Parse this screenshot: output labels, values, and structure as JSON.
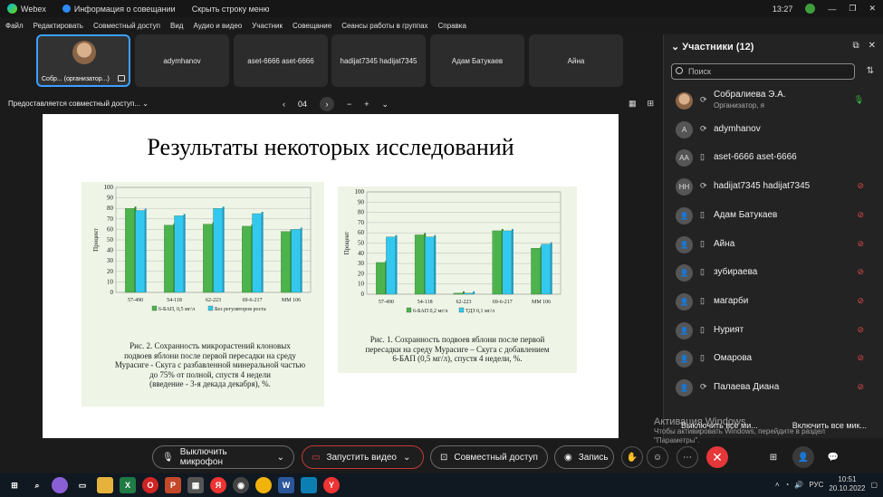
{
  "titlebar": {
    "app": "Webex",
    "meeting_info": "Информация о совещании",
    "hide_menu": "Скрыть строку меню",
    "time": "13:27"
  },
  "menu": [
    "Файл",
    "Редактировать",
    "Совместный доступ",
    "Вид",
    "Аудио и видео",
    "Участник",
    "Совещание",
    "Сеансы работы в группах",
    "Справка"
  ],
  "tiles": [
    {
      "label": "Собр... (организатор...)"
    },
    {
      "label": "adymhanov"
    },
    {
      "label": "aset-6666 aset-6666"
    },
    {
      "label": "hadijat7345 hadijat7345"
    },
    {
      "label": "Адам Батукаев"
    },
    {
      "label": "Айна"
    }
  ],
  "share_bar": {
    "label": "Предоставляется совместный доступ...",
    "page": "04",
    "prev": "‹",
    "next": "›",
    "minus": "−",
    "plus": "+"
  },
  "slide": {
    "title": "Результаты некоторых исследований",
    "caption_left": [
      "Рис. 2. Сохранность микрорастений клоновых",
      "подвоев яблони после первой пересадки на среду",
      "Мурасиге - Скуга с разбавленной минеральной частью",
      "до 75% от полной, спустя 4 недели",
      "(введение - 3-я декада декабря), %."
    ],
    "caption_right": [
      "Рис. 1. Сохранность подвоев яблони после первой",
      "пересадки на среду Мурасиге – Скуга с добавлением",
      "6-БАП (0,5 мг/л), спустя 4 недели, %."
    ]
  },
  "chart_data": [
    {
      "type": "bar",
      "categories": [
        "57-490",
        "54-118",
        "62-223",
        "69-6-217",
        "ММ 106"
      ],
      "series": [
        {
          "name": "6-БАП, 0,5 мг/л",
          "values": [
            80,
            64,
            65,
            63,
            58
          ]
        },
        {
          "name": "Без регуляторов роста",
          "values": [
            78,
            73,
            80,
            75,
            60
          ]
        }
      ],
      "ylabel": "Процент",
      "ylim": [
        0,
        100
      ],
      "yticks": [
        0,
        10,
        20,
        30,
        40,
        50,
        60,
        70,
        80,
        90,
        100
      ],
      "colors": [
        "#4db34d",
        "#33c8ef"
      ],
      "legend": "bottom",
      "grid": true
    },
    {
      "type": "bar",
      "categories": [
        "57-490",
        "54-118",
        "62-223",
        "69-6-217",
        "ММ 106"
      ],
      "series": [
        {
          "name": "6-БАП 0,2 мг/л",
          "values": [
            31,
            58,
            1,
            62,
            45
          ]
        },
        {
          "name": "ТДЗ 0,1 мг/л",
          "values": [
            56,
            56,
            1,
            62,
            49
          ]
        }
      ],
      "ylabel": "Процент",
      "ylim": [
        0,
        100
      ],
      "yticks": [
        0,
        10,
        20,
        30,
        40,
        50,
        60,
        70,
        80,
        90,
        100
      ],
      "colors": [
        "#4db34d",
        "#33c8ef"
      ],
      "legend": "bottom",
      "grid": true
    }
  ],
  "panel": {
    "title": "Участники (12)",
    "search_placeholder": "Поиск",
    "participants": [
      {
        "name": "Собралиева Э.А.",
        "sub": "Организатор, я",
        "initials": "",
        "mic": "on"
      },
      {
        "name": "adymhanov",
        "sub": "",
        "initials": "A",
        "mic": ""
      },
      {
        "name": "aset-6666 aset-6666",
        "sub": "",
        "initials": "AA",
        "mic": ""
      },
      {
        "name": "hadijat7345 hadijat7345",
        "sub": "",
        "initials": "HH",
        "mic": "muted"
      },
      {
        "name": "Адам Батукаев",
        "sub": "",
        "initials": "",
        "mic": "muted"
      },
      {
        "name": "Айна",
        "sub": "",
        "initials": "",
        "mic": "muted"
      },
      {
        "name": "зубираева",
        "sub": "",
        "initials": "",
        "mic": "muted"
      },
      {
        "name": "магарби",
        "sub": "",
        "initials": "",
        "mic": "muted"
      },
      {
        "name": "Нурият",
        "sub": "",
        "initials": "",
        "mic": "muted"
      },
      {
        "name": "Омарова",
        "sub": "",
        "initials": "",
        "mic": "muted"
      },
      {
        "name": "Палаева Диана",
        "sub": "",
        "initials": "",
        "mic": "muted"
      }
    ],
    "mute_all": "Выключить все ми...",
    "unmute_all": "Включить все мик..."
  },
  "watermark": {
    "line1": "Активация Windows",
    "line2": "Чтобы активировать Windows, перейдите в раздел",
    "line3": "\"Параметры\"."
  },
  "controls": {
    "mic": "Выключить микрофон",
    "video": "Запустить видео",
    "share": "Совместный доступ",
    "record": "Запись"
  },
  "taskbar": {
    "lang": "РУС",
    "time": "10:51",
    "date": "20.10.2022"
  }
}
